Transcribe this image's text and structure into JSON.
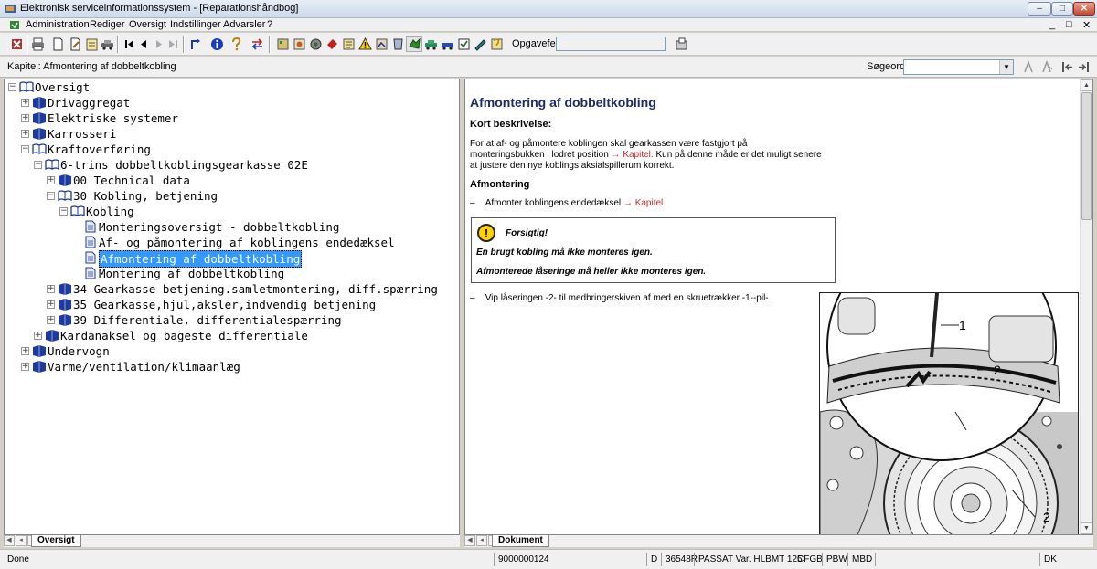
{
  "window": {
    "title": "Elektronisk serviceinformationssystem - [Reparationshåndbog]",
    "controls": [
      "–",
      "□",
      "✕"
    ]
  },
  "menu": {
    "items": [
      "Administration",
      "Rediger",
      "Oversigt",
      "Indstillinger",
      "Advarsler",
      "?"
    ],
    "mdi_controls": [
      "_",
      "□",
      "✕"
    ]
  },
  "toolbar": {
    "opgavefelt_label": "Opgavefelt:",
    "opgavefelt_value": "",
    "icons": [
      "exit-icon",
      "print-icon",
      "new-doc-icon",
      "edit-doc-icon",
      "notes-icon",
      "car-icon",
      "first-icon",
      "prev-icon",
      "next-icon",
      "last-icon",
      "up-level-icon",
      "info-icon",
      "help-icon",
      "swap-icon",
      "doc-a-icon",
      "doc-b-icon",
      "doc-c-icon",
      "doc-d-icon",
      "doc-e-icon",
      "warning-icon",
      "doc-f-icon",
      "doc-g-icon",
      "doc-h-icon",
      "car-green-icon",
      "doc-i-icon",
      "doc-j-icon",
      "doc-k-icon",
      "doc-l-icon",
      "key-icon",
      "settings-icon"
    ]
  },
  "chapter_bar": {
    "label": "Kapitel: Afmontering af dobbeltkobling",
    "search_label": "Søgeord:",
    "search_value": ""
  },
  "tree": [
    {
      "label": "Oversigt",
      "level": 0,
      "expand": "-",
      "icon": "book-open"
    },
    {
      "label": "Drivaggregat",
      "level": 1,
      "expand": "+",
      "icon": "book"
    },
    {
      "label": "Elektriske systemer",
      "level": 1,
      "expand": "+",
      "icon": "book"
    },
    {
      "label": "Karrosseri",
      "level": 1,
      "expand": "+",
      "icon": "book"
    },
    {
      "label": "Kraftoverføring",
      "level": 1,
      "expand": "-",
      "icon": "book-open"
    },
    {
      "label": "6-trins dobbeltkoblingsgearkasse 02E",
      "level": 2,
      "expand": "-",
      "icon": "book-open"
    },
    {
      "label": "00 Technical data",
      "level": 3,
      "expand": "+",
      "icon": "book"
    },
    {
      "label": "30 Kobling, betjening",
      "level": 3,
      "expand": "-",
      "icon": "book-open"
    },
    {
      "label": "Kobling",
      "level": 4,
      "expand": "-",
      "icon": "book-open"
    },
    {
      "label": "Monteringsoversigt - dobbeltkobling",
      "level": 5,
      "expand": "",
      "icon": "page"
    },
    {
      "label": "Af- og påmontering af koblingens endedæksel",
      "level": 5,
      "expand": "",
      "icon": "page"
    },
    {
      "label": "Afmontering af dobbeltkobling",
      "level": 5,
      "expand": "",
      "icon": "page",
      "selected": true
    },
    {
      "label": "Montering af dobbeltkobling",
      "level": 5,
      "expand": "",
      "icon": "page"
    },
    {
      "label": "34 Gearkasse-betjening.samletmontering, diff.spærring",
      "level": 3,
      "expand": "+",
      "icon": "book"
    },
    {
      "label": "35 Gearkasse,hjul,aksler,indvendig betjening",
      "level": 3,
      "expand": "+",
      "icon": "book"
    },
    {
      "label": "39 Differentiale, differentialespærring",
      "level": 3,
      "expand": "+",
      "icon": "book"
    },
    {
      "label": "Kardanaksel og bageste differentiale",
      "level": 2,
      "expand": "+",
      "icon": "book"
    },
    {
      "label": "Undervogn",
      "level": 1,
      "expand": "+",
      "icon": "book"
    },
    {
      "label": "Varme/ventilation/klimaanlæg",
      "level": 1,
      "expand": "+",
      "icon": "book"
    }
  ],
  "left_tab": "Oversigt",
  "right_tab": "Dokument",
  "document": {
    "heading": "Afmontering af dobbeltkobling",
    "short_desc_title": "Kort beskrivelse:",
    "short_desc_lines": [
      "For at af- og påmontere koblingen skal gearkassen være fastgjort på",
      "monteringsbukken i lodret position",
      "Kapitel.",
      "Kun på denne måde er det muligt senere",
      "at justere den nye koblings aksialspillerum korrekt."
    ],
    "section_title": "Afmontering",
    "step1_prefix": "–",
    "step1_text": "Afmonter koblingens endedæksel",
    "step1_link": "Kapitel.",
    "arrow": "→",
    "caution_icon": "!",
    "caution_title": "Forsigtig!",
    "caution_line1": "En brugt kobling må ikke monteres igen.",
    "caution_line2": "Afmonterede låseringe må heller ikke monteres igen.",
    "step2_prefix": "–",
    "step2_text": "Vip låseringen -2- til medbringerskiven af med en skruetrækker -1--pil-.",
    "figure_labels": [
      "1",
      "2",
      "2"
    ]
  },
  "status": {
    "left": "Done",
    "code": "9000000124",
    "mode": "D",
    "id": "36548R",
    "vehicle": "PASSAT Var. HLBMT 125",
    "c1": "CFGB",
    "c2": "PBW",
    "c3": "MBD",
    "lang": "DK"
  },
  "colors": {
    "selection": "#3399ff",
    "heading": "#1b2a6b",
    "link": "#c42b2b",
    "caution_yellow": "#ffd200"
  }
}
